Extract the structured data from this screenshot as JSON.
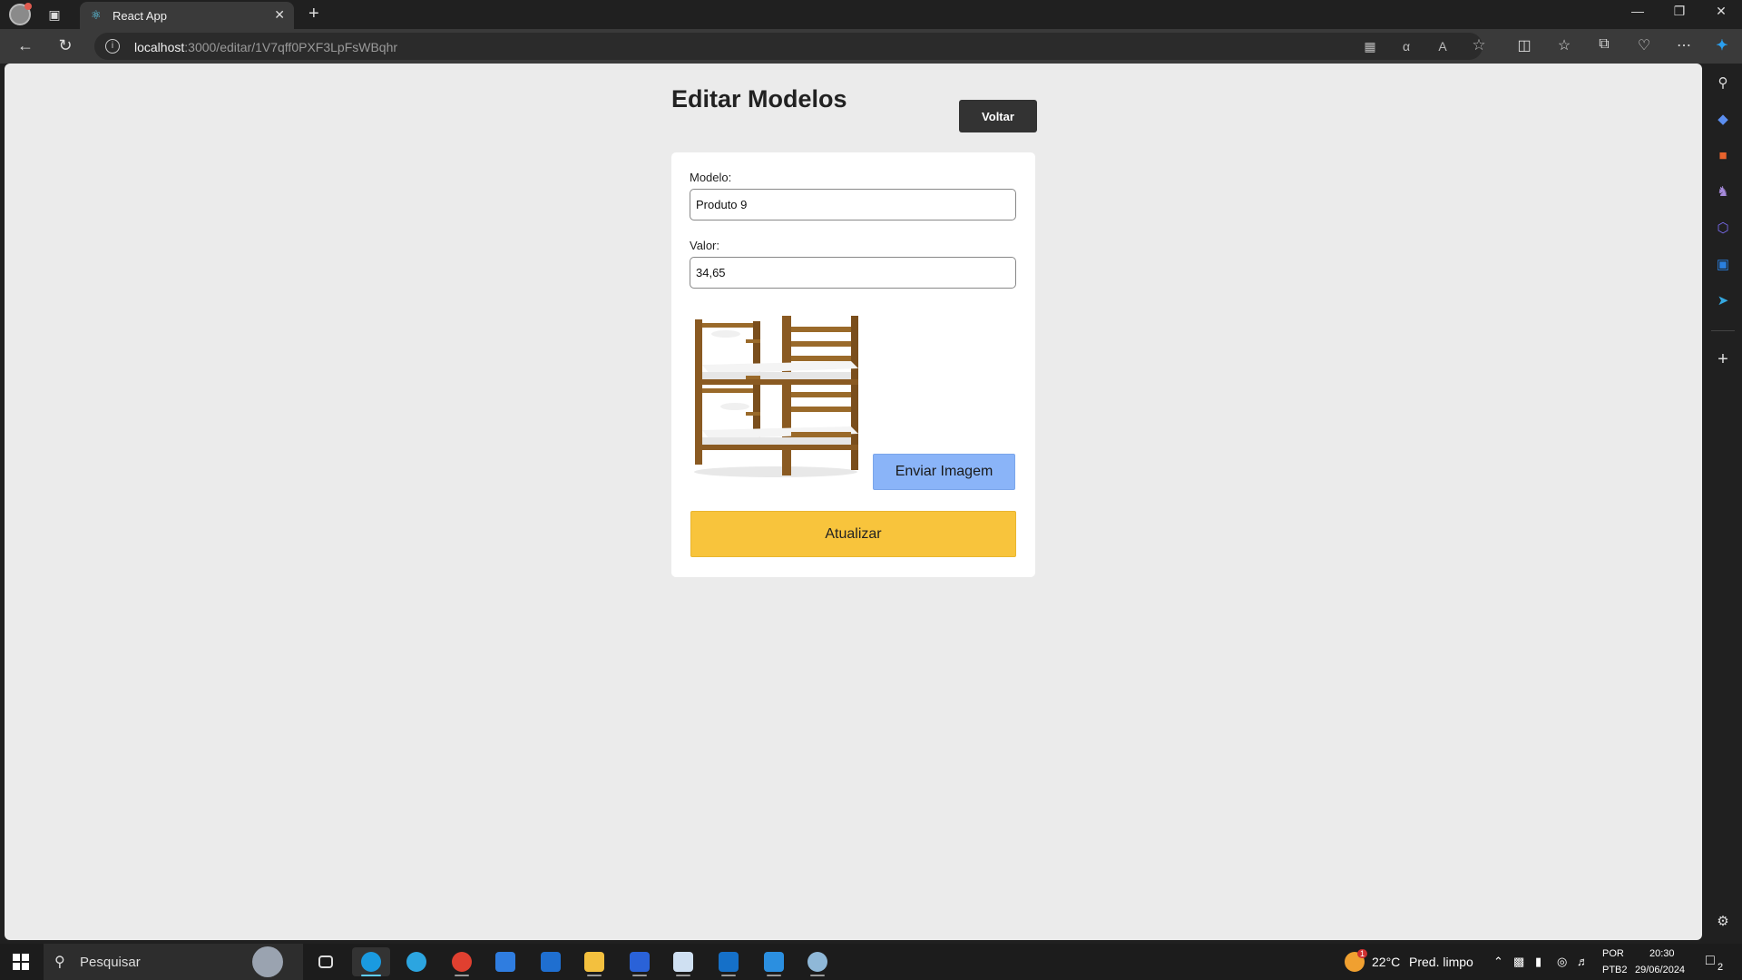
{
  "browser": {
    "tab_title": "React App",
    "url_host": "localhost",
    "url_path": ":3000/editar/1V7qff0PXF3LpFsWBqhr"
  },
  "page": {
    "title": "Editar Modelos",
    "back_label": "Voltar"
  },
  "form": {
    "modelo_label": "Modelo:",
    "modelo_value": "Produto 9",
    "valor_label": "Valor:",
    "valor_value": "34,65",
    "upload_label": "Enviar Imagem",
    "submit_label": "Atualizar"
  },
  "taskbar": {
    "search_placeholder": "Pesquisar",
    "weather_temp": "22°C",
    "weather_desc": "Pred. limpo",
    "lang_top": "POR",
    "lang_bottom": "PTB2",
    "time": "20:30",
    "date": "29/06/2024",
    "notification_count": "2",
    "weather_badge": "1"
  },
  "icons": {
    "tab_favicon": "react-icon",
    "sidebar": [
      "search-icon",
      "shopping-tag-icon",
      "toolbox-icon",
      "chess-icon",
      "copilot-icon",
      "outlook-icon",
      "telegram-icon",
      "add-icon",
      "settings-icon"
    ]
  }
}
